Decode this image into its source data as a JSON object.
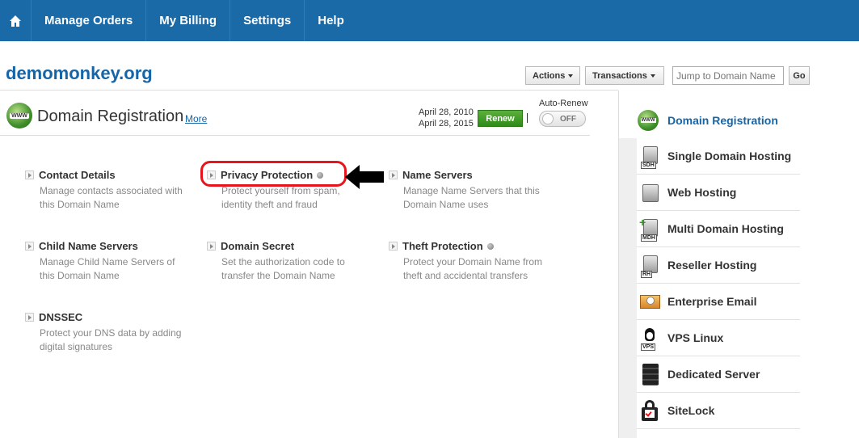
{
  "nav": {
    "home_icon": "home-icon",
    "items": [
      "Manage Orders",
      "My Billing",
      "Settings",
      "Help"
    ]
  },
  "domain": "demomonkey.org",
  "toolbar": {
    "actions_label": "Actions",
    "transactions_label": "Transactions",
    "jump_placeholder": "Jump to Domain Name",
    "go_label": "Go"
  },
  "section": {
    "icon_text": "WWW",
    "title": "Domain Registration",
    "more_label": "More",
    "dates": [
      "April 28, 2010",
      "April 28, 2015"
    ],
    "renew_label": "Renew",
    "separator": "|",
    "auto_renew_label": "Auto-Renew",
    "auto_renew_state": "OFF"
  },
  "items": [
    {
      "name": "Contact Details",
      "desc": [
        "Manage contacts associated with",
        "this Domain Name"
      ]
    },
    {
      "name": "Privacy Protection",
      "desc": [
        "Protect yourself from spam,",
        "identity theft and fraud"
      ]
    },
    {
      "name": "Name Servers",
      "desc": [
        "Manage Name Servers that this",
        "Domain Name uses"
      ]
    },
    {
      "name": "Child Name Servers",
      "desc": [
        "Manage Child Name Servers of",
        "this Domain Name"
      ]
    },
    {
      "name": "Domain Secret",
      "desc": [
        "Set the authorization code to",
        "transfer the Domain Name"
      ]
    },
    {
      "name": "Theft Protection",
      "desc": [
        "Protect your Domain Name from",
        "theft and accidental transfers"
      ]
    },
    {
      "name": "DNSSEC",
      "desc": [
        "Protect your DNS data by adding",
        "digital signatures"
      ]
    }
  ],
  "sidebar": {
    "active": "Domain Registration",
    "items": [
      {
        "label": "Single Domain Hosting",
        "tag": "SDH"
      },
      {
        "label": "Web Hosting",
        "tag": ""
      },
      {
        "label": "Multi Domain Hosting",
        "tag": "MDH"
      },
      {
        "label": "Reseller Hosting",
        "tag": "RH"
      },
      {
        "label": "Enterprise Email",
        "tag": ""
      },
      {
        "label": "VPS Linux",
        "tag": "VPS"
      },
      {
        "label": "Dedicated Server",
        "tag": ""
      },
      {
        "label": "SiteLock",
        "tag": ""
      }
    ]
  },
  "colors": {
    "nav": "#1a6aa8",
    "link": "#1565a7",
    "renew": "#2e8a17",
    "highlight": "#e8141b"
  }
}
